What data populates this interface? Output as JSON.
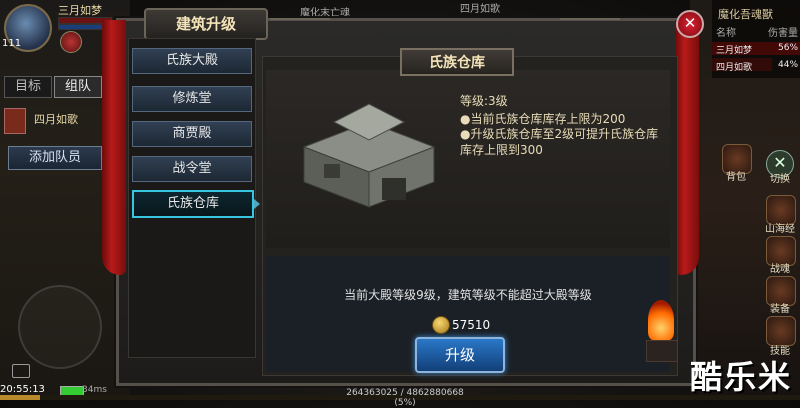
{
  "player": {
    "name": "三月如梦",
    "level": "111",
    "tabs": [
      "目标",
      "组队"
    ],
    "team_member": "四月如歌",
    "add_member": "添加队员",
    "time": "20:55:13",
    "ping": "34ms"
  },
  "top_hint": "魔化末亡魂",
  "top_hint2": "四月如歌",
  "damage_panel": {
    "title": "魔化吾魂獸",
    "col_name": "名称",
    "col_damage": "伤害量",
    "rows": [
      {
        "name": "三月如梦",
        "pct": "56%"
      },
      {
        "name": "四月如歌",
        "pct": "44%"
      }
    ]
  },
  "side_buttons": [
    {
      "label": "背包"
    },
    {
      "label": "切换"
    },
    {
      "label": "山海经"
    },
    {
      "label": "战魂"
    },
    {
      "label": "装备"
    },
    {
      "label": "技能"
    }
  ],
  "dialog": {
    "title": "建筑升级",
    "nav": [
      "氏族大殿",
      "修炼堂",
      "商贾殿",
      "战令堂",
      "氏族仓库"
    ],
    "active_nav": "氏族仓库",
    "section_title": "氏族仓库",
    "level": "等级:3级",
    "desc1": "●当前氏族仓库库存上限为200",
    "desc2": "●升级氏族仓库至2级可提升氏族仓库库存上限到300",
    "notice": "当前大殿等级9级，建筑等级不能超过大殿等级",
    "cost": "57510",
    "upgrade": "升级"
  },
  "xp_text": "264363025 / 4862880668 (5%)",
  "watermark": "酷乐米",
  "colors": {
    "accent_blue": "#2a78c8",
    "active_border": "#36c6e0",
    "curtain_red": "#b81a1a"
  }
}
